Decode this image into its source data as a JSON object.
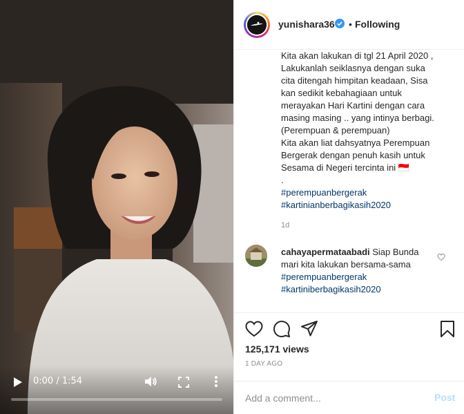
{
  "video": {
    "time": "0:00 / 1:54",
    "progress": 0,
    "icons": {
      "play": "play-icon",
      "volume": "volume-icon",
      "fullscreen": "fullscreen-icon",
      "more": "more-vertical-icon"
    }
  },
  "header": {
    "username": "yunishara36",
    "separator": "•",
    "follow_status": "Following"
  },
  "caption": {
    "lines": [
      "Kita akan lakukan di tgl 21 April 2020 ,",
      "Lakukanlah seiklasnya dengan suka",
      "cita ditengah himpitan keadaan, Sisa",
      "kan sedikit kebahagiaan untuk",
      "merayakan Hari Kartini dengan cara",
      "masing masing .. yang intinya berbagi.",
      "(Perempuan & perempuan)",
      "Kita akan liat dahsyatnya Perempuan",
      "Bergerak dengan penuh kasih untuk",
      "Sesama di Negeri tercinta ini 🇮🇩",
      "."
    ],
    "hashtags": [
      "#perempuanbergerak",
      "#kartinianberbagikasih2020"
    ],
    "time": "1d"
  },
  "comment": {
    "username": "cahayapermataabadi",
    "text_first": "Siap Bunda",
    "text_second": "mari kita lakukan bersama-sama",
    "hashtags": [
      "#perempuanbergerak",
      "#kartiniberbagikasih2020"
    ]
  },
  "stats": {
    "views": "125,171 views",
    "posted": "1 DAY AGO"
  },
  "comment_box": {
    "placeholder": "Add a comment...",
    "post_label": "Post"
  },
  "colors": {
    "link": "#00376b",
    "muted": "#8e8e8e",
    "verified": "#3897f0",
    "post_disabled": "#b2dffc"
  }
}
